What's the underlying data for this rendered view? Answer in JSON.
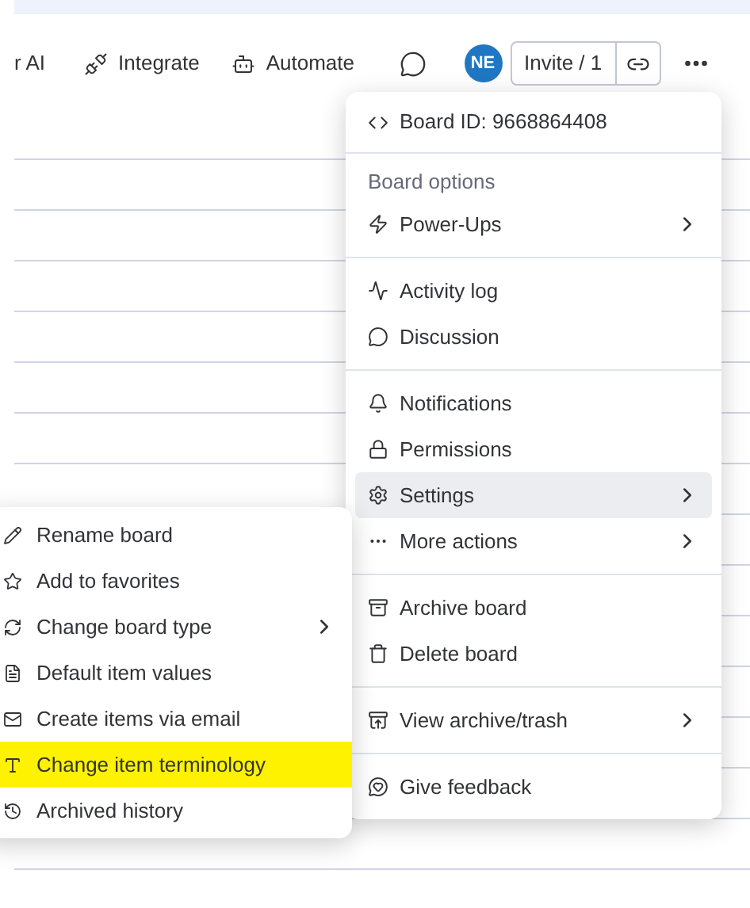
{
  "toolbar": {
    "items": [
      {
        "label": "r AI"
      },
      {
        "label": "Integrate"
      },
      {
        "label": "Automate"
      }
    ],
    "avatar": "NE",
    "invite": "Invite / 1"
  },
  "board_menu": {
    "board_id": "Board ID: 9668864408",
    "sections": [
      {
        "header": "Board options",
        "items": [
          {
            "label": "Power-Ups",
            "submenu": true,
            "selected": false
          }
        ]
      },
      {
        "items": [
          {
            "label": "Activity log",
            "submenu": false,
            "selected": false
          },
          {
            "label": "Discussion",
            "submenu": false,
            "selected": false
          }
        ]
      },
      {
        "items": [
          {
            "label": "Notifications",
            "submenu": false,
            "selected": false
          },
          {
            "label": "Permissions",
            "submenu": false,
            "selected": false
          },
          {
            "label": "Settings",
            "submenu": true,
            "selected": true
          },
          {
            "label": "More actions",
            "submenu": true,
            "selected": false
          }
        ]
      },
      {
        "items": [
          {
            "label": "Archive board",
            "submenu": false,
            "selected": false
          },
          {
            "label": "Delete board",
            "submenu": false,
            "selected": false
          }
        ]
      },
      {
        "items": [
          {
            "label": "View archive/trash",
            "submenu": true,
            "selected": false
          }
        ]
      },
      {
        "items": [
          {
            "label": "Give feedback",
            "submenu": false,
            "selected": false
          }
        ]
      }
    ]
  },
  "settings_menu": {
    "items": [
      {
        "label": "Rename board",
        "submenu": false,
        "highlighted": false
      },
      {
        "label": "Add to favorites",
        "submenu": false,
        "highlighted": false
      },
      {
        "label": "Change board type",
        "submenu": true,
        "highlighted": false
      },
      {
        "label": "Default item values",
        "submenu": false,
        "highlighted": false
      },
      {
        "label": "Create items via email",
        "submenu": false,
        "highlighted": false
      },
      {
        "label": "Change item terminology",
        "submenu": false,
        "highlighted": true
      },
      {
        "label": "Archived history",
        "submenu": false,
        "highlighted": false
      }
    ]
  }
}
